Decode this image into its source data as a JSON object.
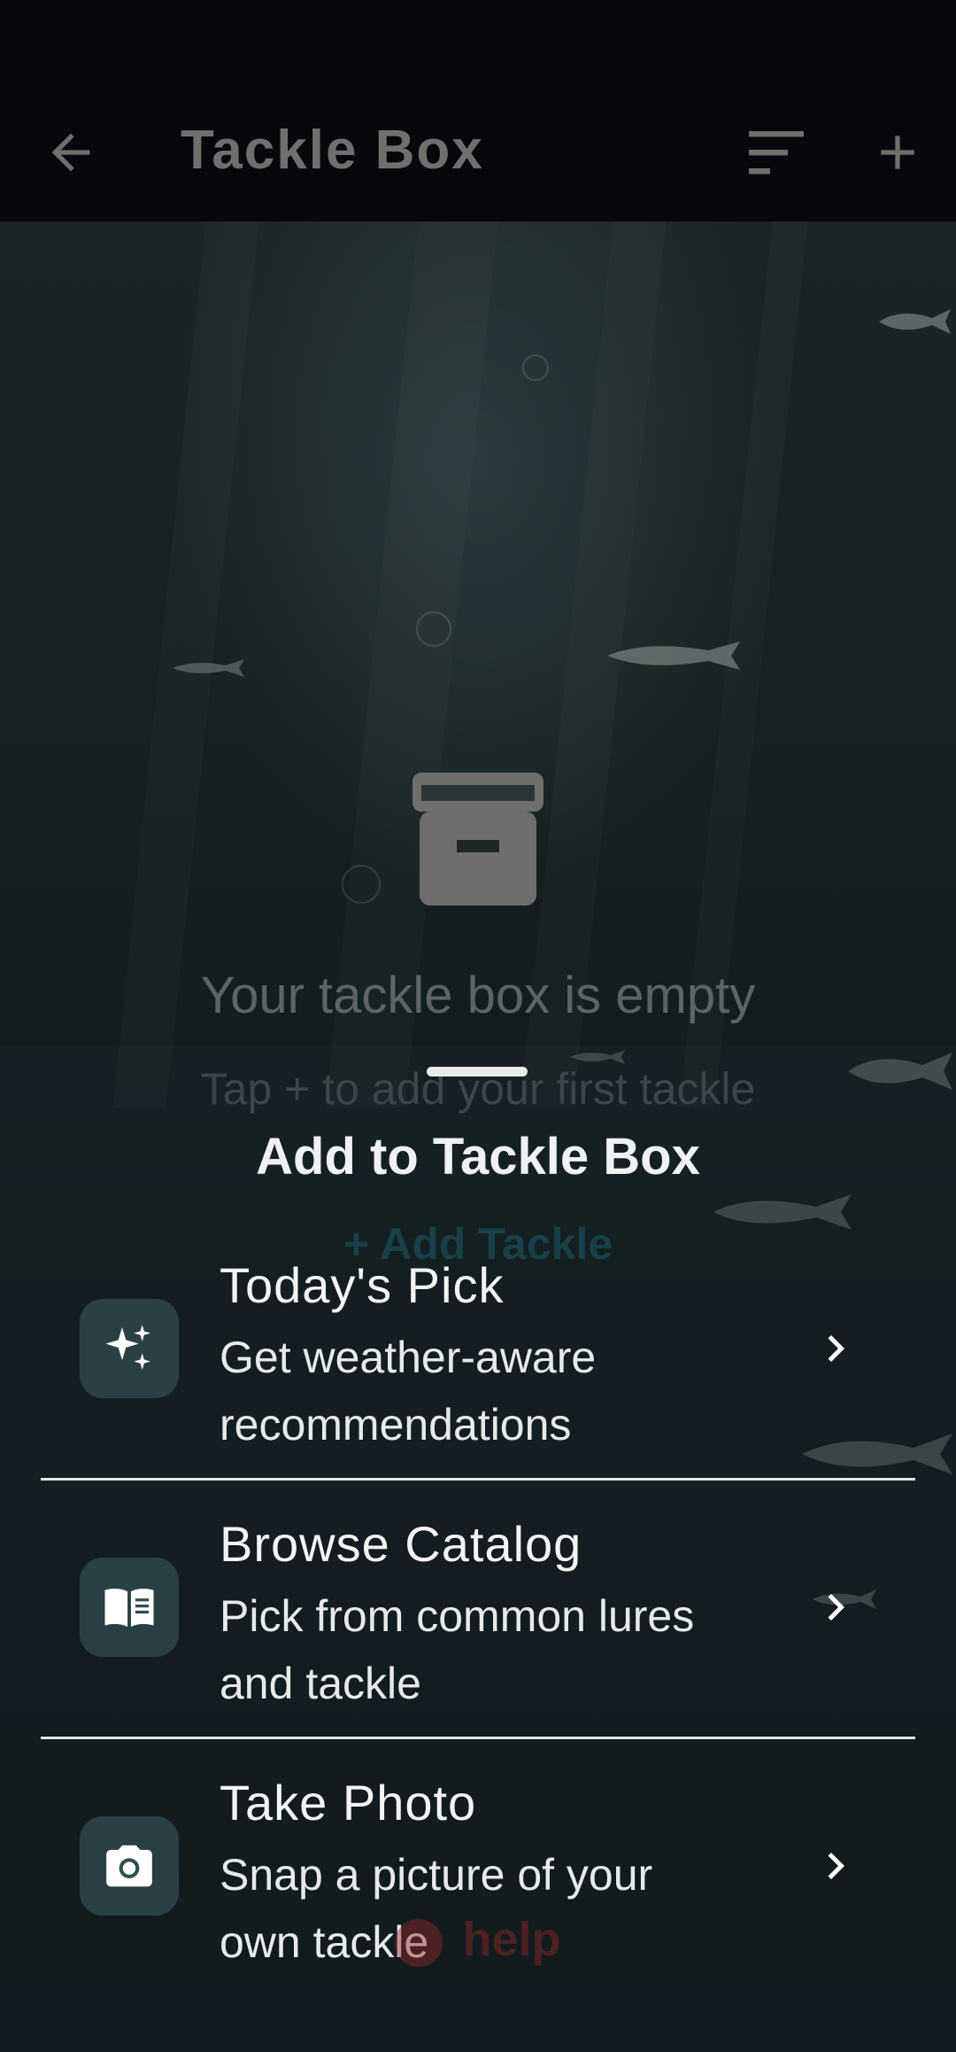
{
  "appbar": {
    "title": "Tackle Box",
    "icons": [
      "arrow-back-icon",
      "sort-icon",
      "add-icon"
    ]
  },
  "empty_state": {
    "icon": "archive-box-icon",
    "title": "Your tackle box is empty",
    "subtitle": "Tap + to add your first tackle",
    "cta": "+ Add Tackle"
  },
  "sheet": {
    "title": "Add to Tackle Box",
    "options": [
      {
        "icon": "sparkles-icon",
        "title": "Today's Pick",
        "desc_line1": "Get weather-aware",
        "desc_line2": "recommendations"
      },
      {
        "icon": "book-icon",
        "title": "Browse Catalog",
        "desc_line1": "Pick from common lures",
        "desc_line2": "and tackle"
      },
      {
        "icon": "camera-icon",
        "title": "Take Photo",
        "desc_line1": "Snap a picture of your",
        "desc_line2": "own tackle"
      }
    ]
  },
  "help": {
    "label": "help"
  },
  "colors": {
    "appbar_bg": "#06080d",
    "sheet_text": "#f2f4f5",
    "icon_tile": "#3c5c62",
    "cta_muted": "#17414a"
  }
}
